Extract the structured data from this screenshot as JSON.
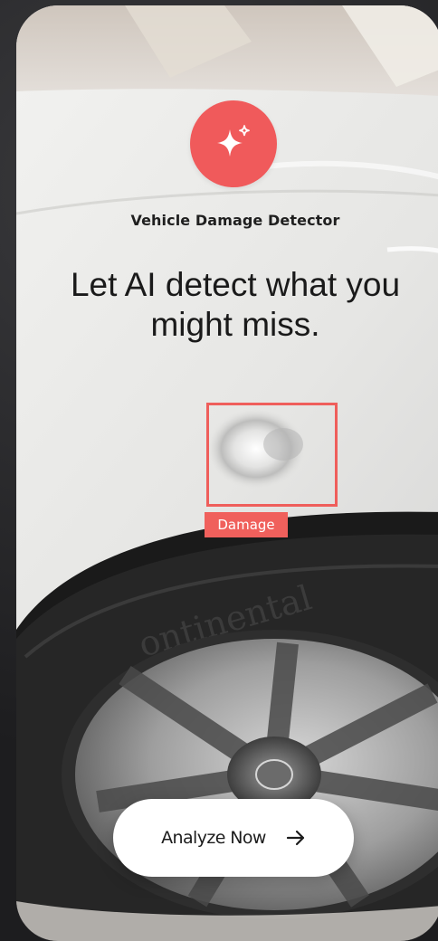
{
  "app": {
    "name": "Vehicle Damage Detector",
    "logo_icon": "sparkle-icon",
    "brand_color": "#f05a5b"
  },
  "hero": {
    "headline": "Let AI detect what you might miss."
  },
  "detection": {
    "label": "Damage",
    "color": "#ef5e5b"
  },
  "cta": {
    "label": "Analyze Now",
    "icon": "arrow-right-icon"
  }
}
